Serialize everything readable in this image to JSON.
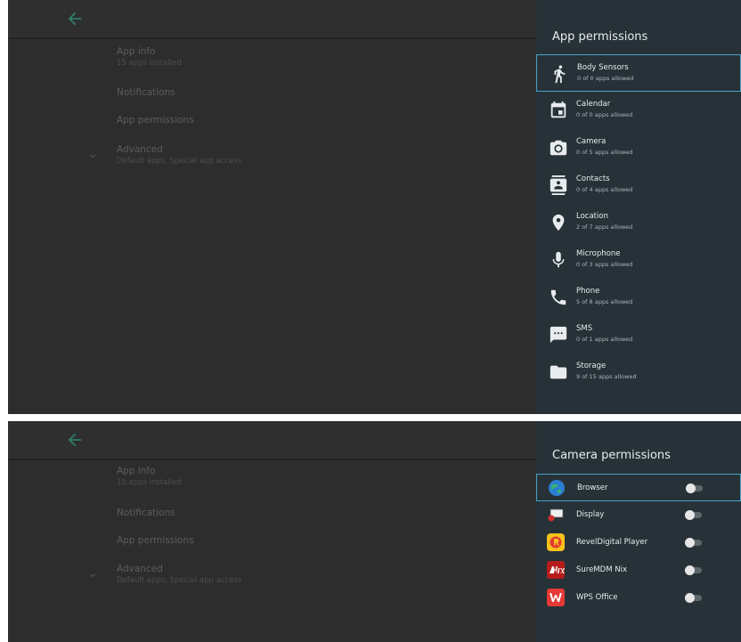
{
  "menu": {
    "items": [
      {
        "title": "App info",
        "subtitle": "15 apps installed"
      },
      {
        "title": "Notifications",
        "subtitle": ""
      },
      {
        "title": "App permissions",
        "subtitle": ""
      },
      {
        "title": "Advanced",
        "subtitle": "Default apps, Special app access"
      }
    ]
  },
  "app_permissions_panel": {
    "title": "App permissions",
    "items": [
      {
        "name": "Body Sensors",
        "count": "0 of 0 apps allowed",
        "icon": "body-sensors-icon"
      },
      {
        "name": "Calendar",
        "count": "0 of 0 apps allowed",
        "icon": "calendar-icon"
      },
      {
        "name": "Camera",
        "count": "0 of 5 apps allowed",
        "icon": "camera-icon"
      },
      {
        "name": "Contacts",
        "count": "0 of 4 apps allowed",
        "icon": "contacts-icon"
      },
      {
        "name": "Location",
        "count": "2 of 7 apps allowed",
        "icon": "location-icon"
      },
      {
        "name": "Microphone",
        "count": "0 of 3 apps allowed",
        "icon": "microphone-icon"
      },
      {
        "name": "Phone",
        "count": "5 of 8 apps allowed",
        "icon": "phone-icon"
      },
      {
        "name": "SMS",
        "count": "0 of 1 apps allowed",
        "icon": "sms-icon"
      },
      {
        "name": "Storage",
        "count": "9 of 15 apps allowed",
        "icon": "storage-icon"
      }
    ]
  },
  "camera_permissions_panel": {
    "title": "Camera permissions",
    "apps": [
      {
        "name": "Browser",
        "icon": "browser-icon",
        "allowed": false
      },
      {
        "name": "Display",
        "icon": "display-app-icon",
        "allowed": false
      },
      {
        "name": "RevelDigital Player",
        "icon": "reveldigital-icon",
        "allowed": false
      },
      {
        "name": "SureMDM Nix",
        "icon": "suremdm-nix-icon",
        "allowed": false
      },
      {
        "name": "WPS Office",
        "icon": "wps-office-icon",
        "allowed": false
      }
    ]
  },
  "colors": {
    "background": "#2d2d2d",
    "panel": "#263238",
    "focus_border": "#4aa3c8",
    "back_arrow": "#2e7d6b"
  }
}
